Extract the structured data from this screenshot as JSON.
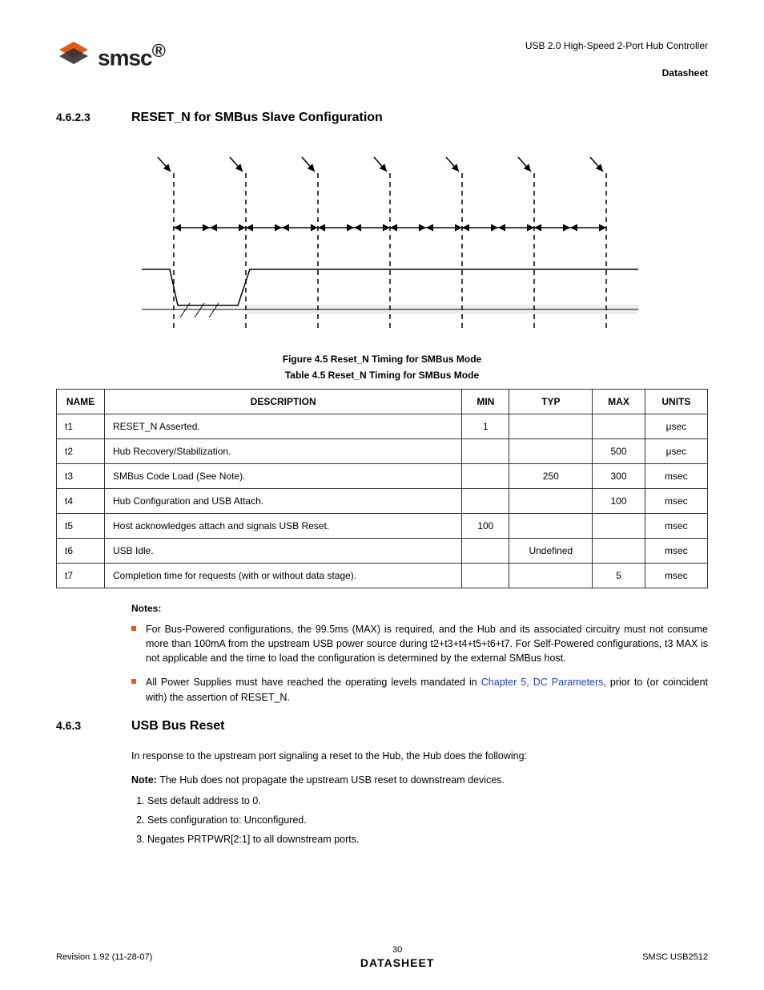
{
  "header": {
    "product": "USB 2.0 High-Speed 2-Port Hub Controller",
    "doctype": "Datasheet",
    "logo_text": "smsc",
    "regmark": "®"
  },
  "section1": {
    "num": "4.6.2.3",
    "title": "RESET_N for SMBus Slave Configuration"
  },
  "figure": {
    "caption": "Figure 4.5 Reset_N Timing for SMBus Mode"
  },
  "table": {
    "caption": "Table 4.5  Reset_N Timing for SMBus Mode",
    "head": {
      "name": "NAME",
      "desc": "DESCRIPTION",
      "min": "MIN",
      "typ": "TYP",
      "max": "MAX",
      "units": "UNITS"
    },
    "rows": [
      {
        "name": "t1",
        "desc": "RESET_N Asserted.",
        "min": "1",
        "typ": "",
        "max": "",
        "units": "μsec"
      },
      {
        "name": "t2",
        "desc": "Hub Recovery/Stabilization.",
        "min": "",
        "typ": "",
        "max": "500",
        "units": "μsec"
      },
      {
        "name": "t3",
        "desc": "SMBus Code Load (See Note).",
        "min": "",
        "typ": "250",
        "max": "300",
        "units": "msec"
      },
      {
        "name": "t4",
        "desc": "Hub Configuration and USB Attach.",
        "min": "",
        "typ": "",
        "max": "100",
        "units": "msec"
      },
      {
        "name": "t5",
        "desc": "Host acknowledges attach and signals USB Reset.",
        "min": "100",
        "typ": "",
        "max": "",
        "units": "msec"
      },
      {
        "name": "t6",
        "desc": "USB Idle.",
        "min": "",
        "typ": "Undefined",
        "max": "",
        "units": "msec"
      },
      {
        "name": "t7",
        "desc": "Completion time for requests (with or without data stage).",
        "min": "",
        "typ": "",
        "max": "5",
        "units": "msec"
      }
    ]
  },
  "notes": {
    "heading": "Notes:",
    "items": [
      "For Bus-Powered configurations, the 99.5ms (MAX) is required, and the Hub and its associated circuitry must not consume more than 100mA from the upstream USB power source during t2+t3+t4+t5+t6+t7. For Self-Powered configurations, t3 MAX is not applicable and the time to load the configuration is determined by the external SMBus host."
    ],
    "item2_pre": "All Power Supplies must have reached the operating levels mandated in ",
    "item2_link": "Chapter 5, DC Parameters",
    "item2_post": ", prior to (or coincident with) the assertion of RESET_N."
  },
  "section2": {
    "num": "4.6.3",
    "title": "USB Bus Reset",
    "intro": "In response to the upstream port signaling a reset to the Hub, the Hub does the following:",
    "note_label": "Note:",
    "note_text": "  The Hub does not propagate the upstream USB reset to downstream devices.",
    "steps": [
      "Sets default address to 0.",
      "Sets configuration to: Unconfigured.",
      "Negates PRTPWR[2:1] to all downstream ports."
    ]
  },
  "footer": {
    "left": "Revision 1.92 (11-28-07)",
    "page": "30",
    "right": "SMSC USB2512",
    "ds": "DATASHEET"
  }
}
